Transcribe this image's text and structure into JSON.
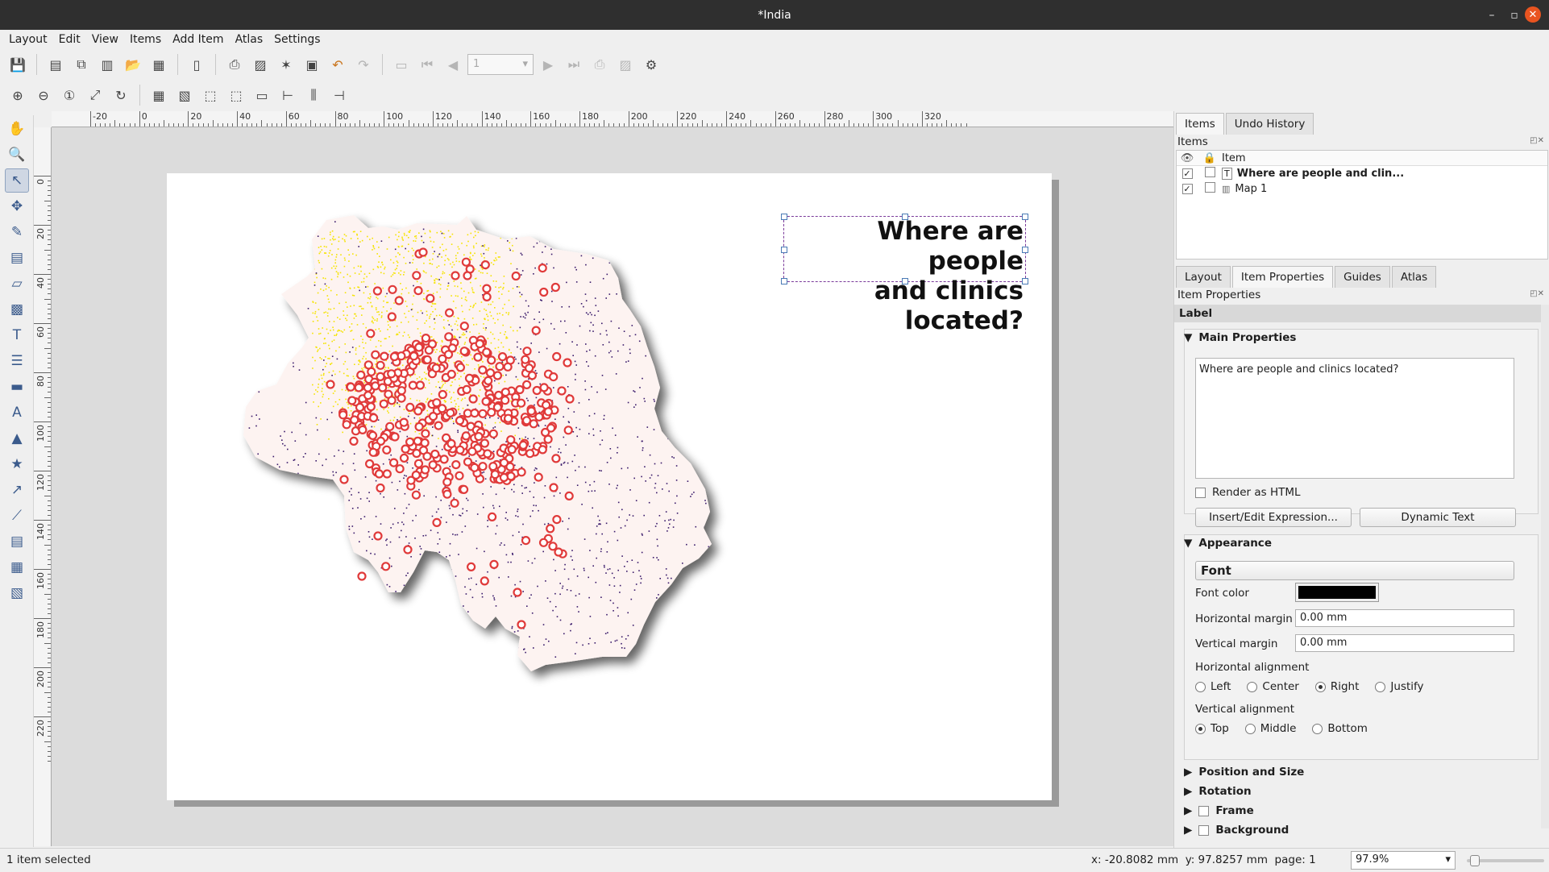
{
  "window": {
    "title": "*India"
  },
  "menu": [
    "Layout",
    "Edit",
    "View",
    "Items",
    "Add Item",
    "Atlas",
    "Settings"
  ],
  "toolbar": {
    "page_value": "1"
  },
  "ruler": {
    "h_labels": [
      "-20",
      "0",
      "20",
      "40",
      "60",
      "80",
      "100",
      "120",
      "140",
      "160",
      "180",
      "200",
      "220",
      "240",
      "260",
      "280",
      "300",
      "320"
    ],
    "v_labels": [
      "0",
      "20",
      "40",
      "60",
      "80",
      "100",
      "120",
      "140",
      "160",
      "180",
      "200",
      "220"
    ]
  },
  "canvas": {
    "label_text_line1": "Where are people",
    "label_text_line2": "and clinics located?",
    "map_colors": {
      "people_high": "#f5e400",
      "people_low": "#3a1a6b",
      "clinic": "#e03a3a",
      "land": "#fdf3f1"
    }
  },
  "right_panel": {
    "top_tabs": [
      "Items",
      "Undo History"
    ],
    "items_header": "Items",
    "col_item": "Item",
    "items": [
      {
        "name": "Where are people and clin...",
        "visible": "✓",
        "bold": true
      },
      {
        "name": "Map 1",
        "visible": "✓",
        "bold": false
      }
    ],
    "prop_tabs": [
      "Layout",
      "Item Properties",
      "Guides",
      "Atlas"
    ],
    "props_header": "Item Properties",
    "section_title": "Label",
    "main_props": {
      "title": "Main Properties",
      "text": "Where are people and clinics located?",
      "render_html": "Render as HTML",
      "insert_btn": "Insert/Edit Expression...",
      "dynamic_btn": "Dynamic Text"
    },
    "appearance": {
      "title": "Appearance",
      "font_btn": "Font",
      "font_color_label": "Font color",
      "font_color": "#000000",
      "hmargin_label": "Horizontal margin",
      "hmargin": "0.00 mm",
      "vmargin_label": "Vertical margin",
      "vmargin": "0.00 mm",
      "halign_label": "Horizontal alignment",
      "halign": [
        "Left",
        "Center",
        "Right",
        "Justify"
      ],
      "valign_label": "Vertical alignment",
      "valign": [
        "Top",
        "Middle",
        "Bottom"
      ]
    },
    "collapsed": [
      "Position and Size",
      "Rotation",
      "Frame",
      "Background"
    ]
  },
  "status": {
    "left": "1 item selected",
    "coords": "x: -20.8082 mm  y: 97.8257 mm  page: 1",
    "zoom": "97.9%"
  }
}
